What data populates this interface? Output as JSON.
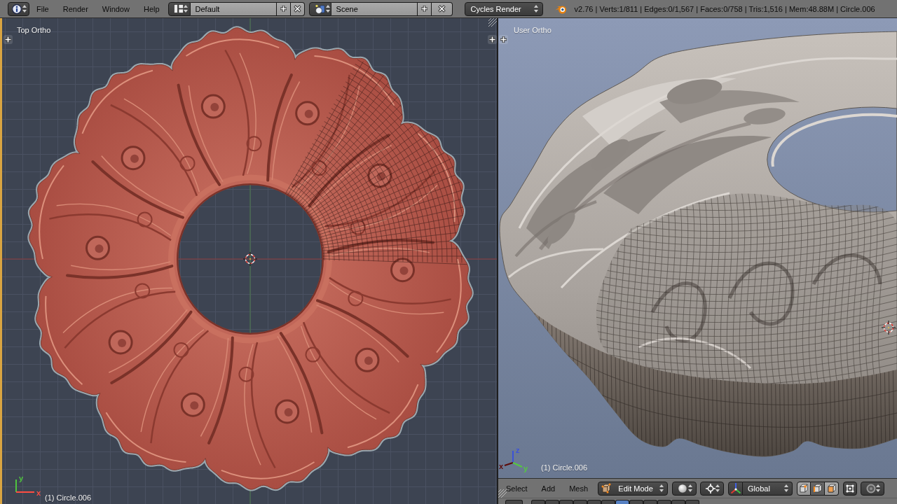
{
  "top_bar": {
    "menus": [
      "File",
      "Render",
      "Window",
      "Help"
    ],
    "screen_layout": "Default",
    "scene": "Scene",
    "render_engine": "Cycles Render",
    "stats": "v2.76 | Verts:1/811 | Edges:0/1,567 | Faces:0/758 | Tris:1,516 | Mem:48.88M | Circle.006"
  },
  "viewports": [
    {
      "kind": "top",
      "view_label": "Top Ortho",
      "object_label": "(1) Circle.006",
      "gizmo": [
        {
          "label": "y",
          "color": "#4fc43e"
        },
        {
          "label": "x",
          "color": "#ff4d42"
        }
      ]
    },
    {
      "kind": "user",
      "view_label": "User Ortho",
      "object_label": "(1) Circle.006",
      "gizmo": [
        {
          "label": "z",
          "color": "#3b52d8"
        },
        {
          "label": "x",
          "color": "#5c0b09"
        },
        {
          "label": "y",
          "color": "#55c840"
        }
      ]
    }
  ],
  "view_header": {
    "menus": [
      "Select",
      "Add",
      "Mesh"
    ],
    "mode": "Edit Mode",
    "orientation": "Global",
    "select_modes": [
      {
        "kind": "vertex",
        "selected": false
      },
      {
        "kind": "edge",
        "selected": true
      },
      {
        "kind": "face",
        "selected": false
      }
    ],
    "toolbar": [
      {
        "selected": false
      },
      {
        "selected": false
      },
      {
        "selected": false
      },
      {
        "selected": false
      },
      {
        "selected": false
      },
      {
        "selected": false
      },
      {
        "selected": false
      },
      {
        "selected": true
      },
      {
        "selected": false
      },
      {
        "selected": false
      },
      {
        "selected": false
      },
      {
        "selected": false
      },
      {
        "selected": false
      }
    ]
  }
}
